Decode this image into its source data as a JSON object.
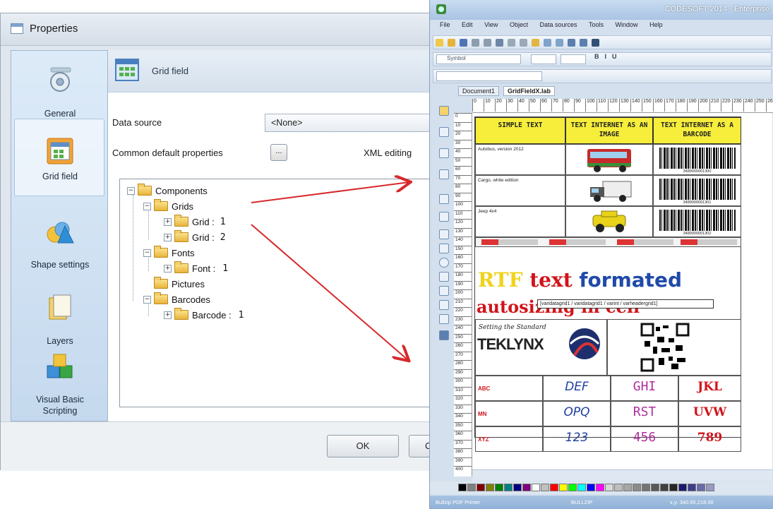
{
  "dialog": {
    "title": "Properties",
    "sidebar": [
      {
        "label": "General",
        "icon": "general-settings-icon"
      },
      {
        "label": "Grid field",
        "icon": "grid-field-icon",
        "selected": true
      },
      {
        "label": "Shape settings",
        "icon": "shape-settings-icon"
      },
      {
        "label": "Layers",
        "icon": "layers-icon"
      },
      {
        "label": "Visual Basic Scripting",
        "icon": "vb-scripting-icon"
      }
    ],
    "header": {
      "title": "Grid field"
    },
    "data_source": {
      "label": "Data source",
      "value": "<None>"
    },
    "common_default": {
      "label": "Common default properties",
      "button": "..."
    },
    "xml_editing": "XML editing",
    "tree": {
      "root": "Components",
      "grids": "Grids",
      "grid1_name": "Grid :",
      "grid1_num": "1",
      "grid2_name": "Grid :",
      "grid2_num": "2",
      "fonts": "Fonts",
      "font1_name": "Font :",
      "font1_num": "1",
      "pictures": "Pictures",
      "barcodes": "Barcodes",
      "barcode1_name": "Barcode :",
      "barcode1_num": "1"
    },
    "buttons": {
      "ok": "OK",
      "cancel": "C"
    }
  },
  "codesoft": {
    "title": "CODESOFT 2014 - Enterprise",
    "menu": [
      "File",
      "Edit",
      "View",
      "Object",
      "Data sources",
      "Tools",
      "Window",
      "Help"
    ],
    "font_box": "Symbol",
    "tabs": [
      "Document1",
      "GridFieldX.lab"
    ],
    "headers": [
      "SIMPLE TEXT",
      "TEXT INTERNET AS AN IMAGE",
      "TEXT INTERNET AS A BARCODE"
    ],
    "rows": [
      {
        "text": "Autobus, version 2012",
        "barcode": "3489000001300"
      },
      {
        "text": "Cargo, white edition",
        "barcode": "3489000001301"
      },
      {
        "text": "Jeep 4x4",
        "barcode": "3489000001302"
      }
    ],
    "rtf_parts": {
      "rtf": "RTF ",
      "text": "text ",
      "formated": "formated"
    },
    "autosize": "autosizing in cell",
    "varbox": "[varidatagrid1 / varidatagrid1 / varint / varheadergrid1]",
    "setting": "Setting the Standard",
    "brand": "TEKLYNX",
    "grid2": [
      [
        "ABC",
        "DEF",
        "GHI",
        "JKL"
      ],
      [
        "MN",
        "OPQ",
        "RST",
        "UVW"
      ],
      [
        "XYZ",
        "123",
        "456",
        "789"
      ]
    ],
    "status": "Bullzip PDF Printer",
    "status_mid": "BULLZIP",
    "status_right": "x,y: 340.65,218.00",
    "colors": [
      "#000000",
      "#808080",
      "#800000",
      "#808000",
      "#008000",
      "#008080",
      "#000080",
      "#800080",
      "#ffffff",
      "#c0c0c0",
      "#ff0000",
      "#ffff00",
      "#00ff00",
      "#00ffff",
      "#0000ff",
      "#ff00ff",
      "#d9d9d9",
      "#bfbfbf",
      "#a6a6a6",
      "#8c8c8c",
      "#737373",
      "#595959",
      "#404040",
      "#262626",
      "#1a1a6e",
      "#3c3c8c",
      "#6a6aa8",
      "#9999c4"
    ]
  }
}
